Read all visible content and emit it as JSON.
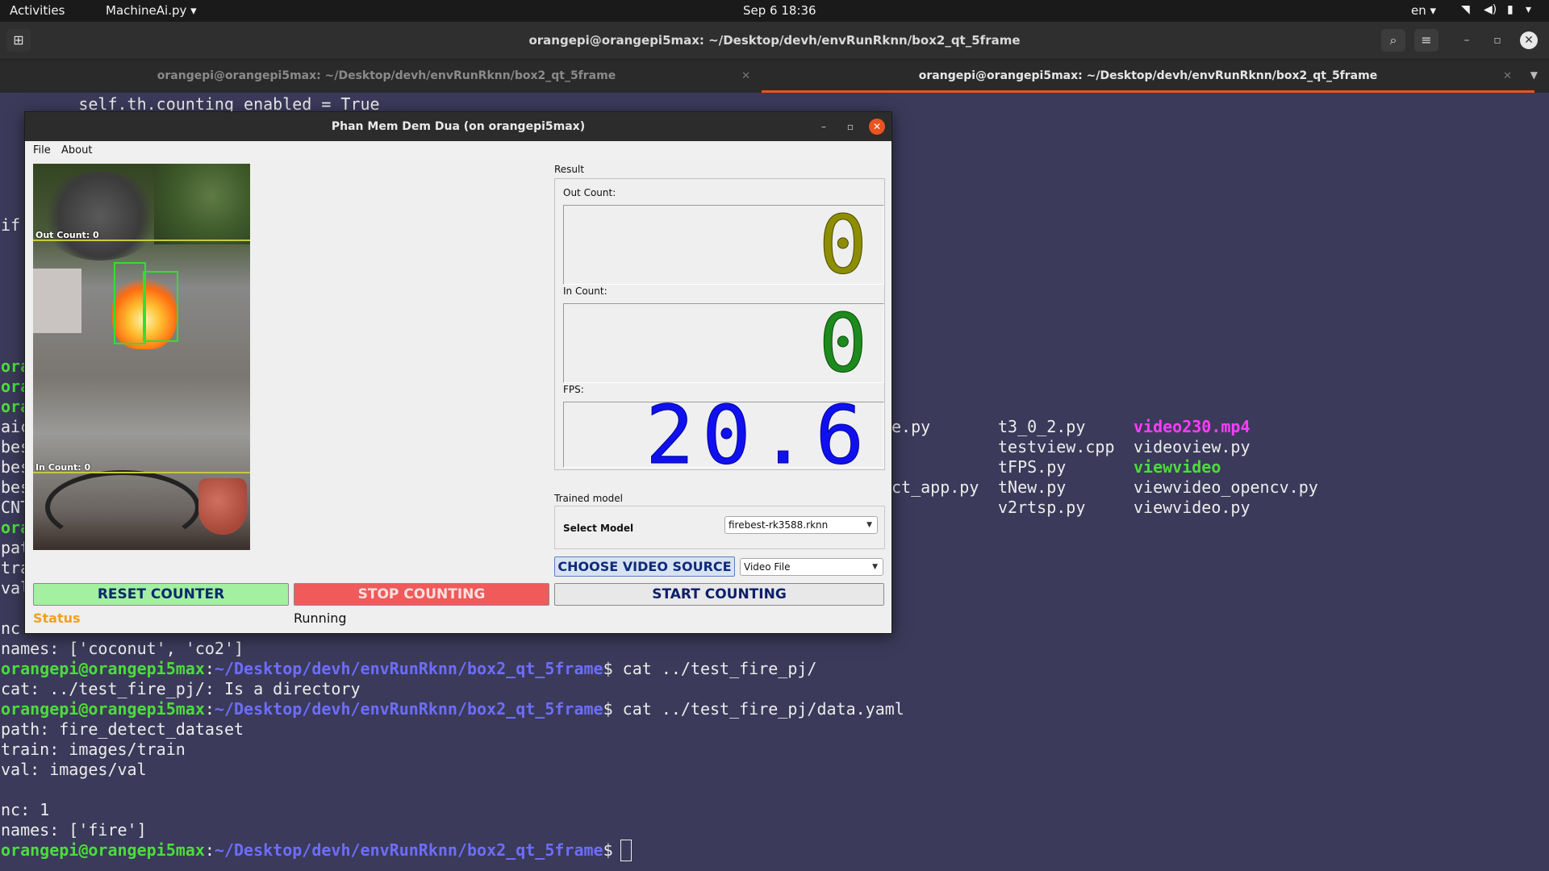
{
  "topbar": {
    "activities": "Activities",
    "app_menu": "MachineAi.py",
    "clock": "Sep 6  18:36",
    "lang": "en"
  },
  "terminal": {
    "title": "orangepi@orangepi5max: ~/Desktop/devh/envRunRknn/box2_qt_5frame",
    "tabs": [
      {
        "label": "orangepi@orangepi5max: ~/Desktop/devh/envRunRknn/box2_qt_5frame"
      },
      {
        "label": "orangepi@orangepi5max: ~/Desktop/devh/envRunRknn/box2_qt_5frame"
      }
    ],
    "line_top": "        self.th.counting_enabled = True",
    "line_if": "if",
    "left_fragments": [
      "ora",
      "ora",
      "ora",
      "aic",
      "bes",
      "bes",
      "bes",
      "CNT",
      "ora",
      "pat",
      "tra",
      "val",
      "",
      "nc",
      "names: ['coconut', 'co2']"
    ],
    "files": {
      "col1": [
        "e.py",
        "",
        "ct_app.py",
        ""
      ],
      "col2": [
        "t3_0_2.py",
        "testview.cpp",
        "tFPS.py",
        "tNew.py",
        "v2rtsp.py"
      ],
      "col3": [
        "video230.mp4",
        "videoview.py",
        "viewvideo",
        "viewvideo_opencv.py",
        "viewvideo.py"
      ]
    },
    "prompt_user": "orangepi@orangepi5max",
    "prompt_path": "~/Desktop/devh/envRunRknn/box2_qt_5frame",
    "cmd1": " cat ../test_fire_pj/",
    "out1": "cat: ../test_fire_pj/: Is a directory",
    "cmd2": " cat ../test_fire_pj/data.yaml",
    "yaml": [
      "path: fire_detect_dataset",
      "train: images/train",
      "val: images/val",
      "",
      "nc: 1",
      "names: ['fire']"
    ]
  },
  "app": {
    "title": "Phan Mem Dem Dua (on orangepi5max)",
    "menu": [
      "File",
      "About"
    ],
    "video_overlay": {
      "out": "Out Count: 0",
      "in": "In Count: 0"
    },
    "result_label": "Result",
    "out_label": "Out Count:",
    "out_value": "0",
    "in_label": "In Count:",
    "in_value": "0",
    "fps_label": "FPS:",
    "fps_value": "20.6",
    "trained_label": "Trained model",
    "select_label": "Select Model",
    "model_value": "firebest-rk3588.rknn",
    "choose_label": "CHOOSE VIDEO SOURCE",
    "source_value": "Video File",
    "reset_label": "RESET COUNTER",
    "stop_label": "STOP COUNTING",
    "start_label": "START COUNTING",
    "status_label": "Status",
    "status_value": "Running"
  },
  "colors": {
    "accent": "#e95420",
    "prompt_green": "#4cdc3c",
    "prompt_blue": "#6d6dff",
    "terminal_bg": "#3b3a5a",
    "out_lcd": "#8d8d00",
    "in_lcd": "#1c8a1c",
    "fps_lcd": "#1010ee",
    "reset_bg": "#a3f0a0",
    "stop_bg": "#f05a5a",
    "status_orange": "#f0a020"
  }
}
